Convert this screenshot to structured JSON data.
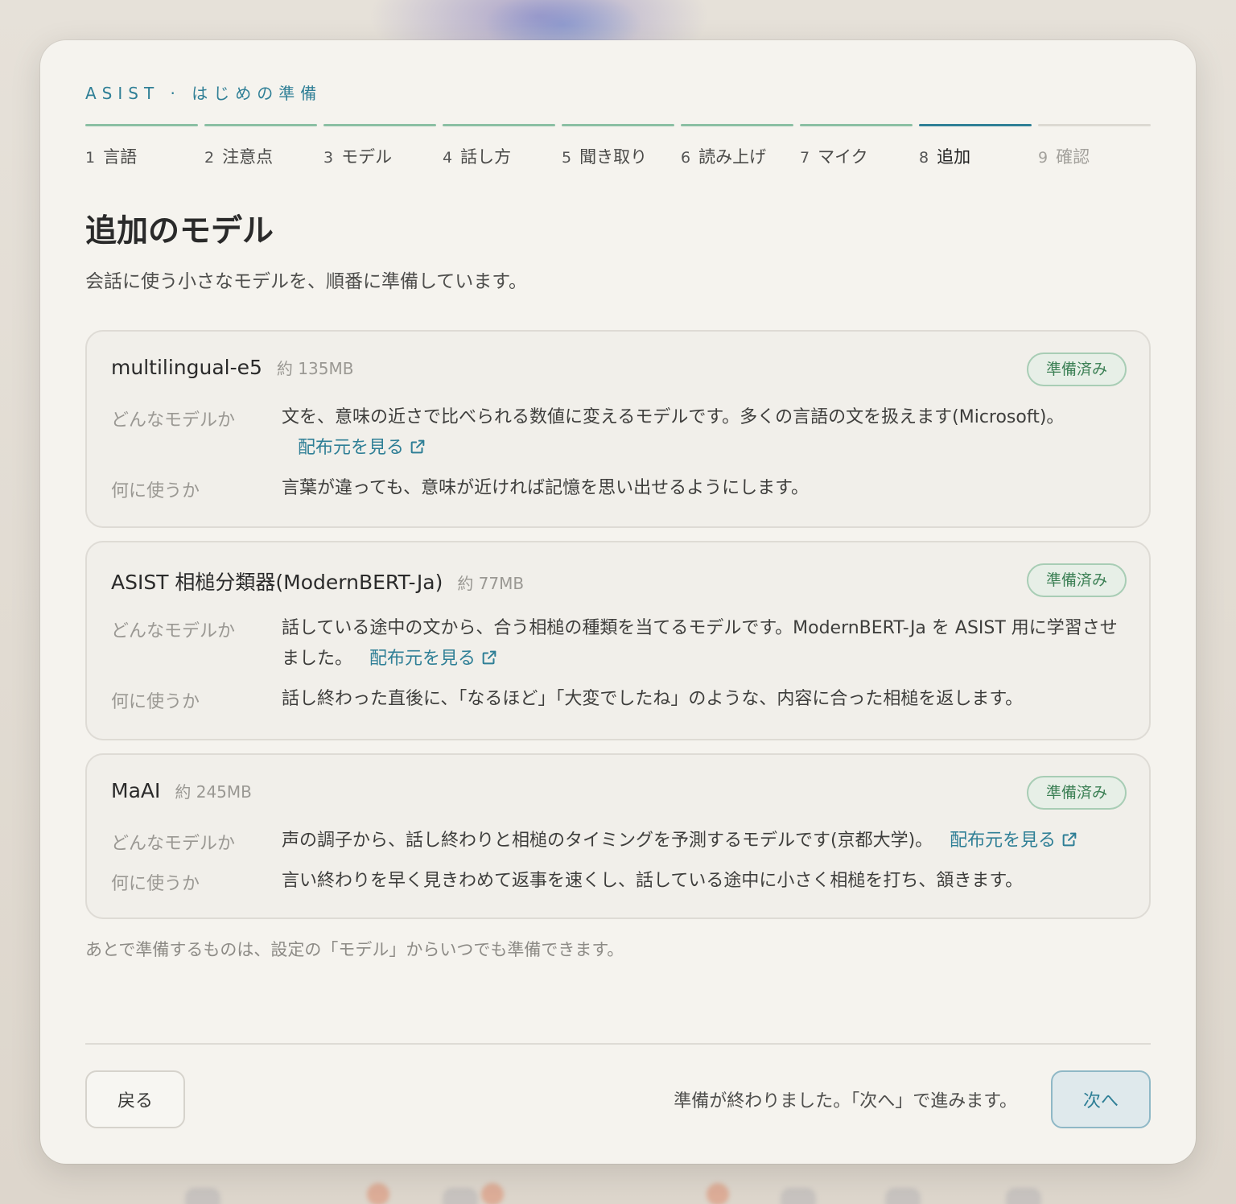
{
  "header": {
    "eyebrow": "ASIST · はじめの準備"
  },
  "steps": [
    {
      "num": "1",
      "label": "言語",
      "state": "done"
    },
    {
      "num": "2",
      "label": "注意点",
      "state": "done"
    },
    {
      "num": "3",
      "label": "モデル",
      "state": "done"
    },
    {
      "num": "4",
      "label": "話し方",
      "state": "done"
    },
    {
      "num": "5",
      "label": "聞き取り",
      "state": "done"
    },
    {
      "num": "6",
      "label": "読み上げ",
      "state": "done"
    },
    {
      "num": "7",
      "label": "マイク",
      "state": "done"
    },
    {
      "num": "8",
      "label": "追加",
      "state": "current"
    },
    {
      "num": "9",
      "label": "確認",
      "state": "future"
    }
  ],
  "page": {
    "title": "追加のモデル",
    "subtitle": "会話に使う小さなモデルを、順番に準備しています。"
  },
  "labels": {
    "what": "どんなモデルか",
    "use": "何に使うか",
    "source_link": "配布元を見る"
  },
  "models": [
    {
      "name": "multilingual-e5",
      "size": "約 135MB",
      "status": "準備済み",
      "description": "文を、意味の近さで比べられる数値に変えるモデルです。多くの言語の文を扱えます(Microsoft)。",
      "usage": "言葉が違っても、意味が近ければ記憶を思い出せるようにします。"
    },
    {
      "name": "ASIST 相槌分類器(ModernBERT-Ja)",
      "size": "約 77MB",
      "status": "準備済み",
      "description": "話している途中の文から、合う相槌の種類を当てるモデルです。ModernBERT-Ja を ASIST 用に学習させました。",
      "usage": "話し終わった直後に、「なるほど」「大変でしたね」のような、内容に合った相槌を返します。"
    },
    {
      "name": "MaAI",
      "size": "約 245MB",
      "status": "準備済み",
      "description": "声の調子から、話し終わりと相槌のタイミングを予測するモデルです(京都大学)。",
      "usage": "言い終わりを早く見きわめて返事を速くし、話している途中に小さく相槌を打ち、頷きます。"
    }
  ],
  "note": "あとで準備するものは、設定の「モデル」からいつでも準備できます。",
  "footer": {
    "back_label": "戻る",
    "status": "準備が終わりました。「次へ」で進みます。",
    "next_label": "次へ"
  },
  "colors": {
    "accent": "#2f7f96",
    "step_done": "#8bbfa3",
    "step_future": "#dcd9d2",
    "ready_badge": "#3c8055",
    "background": "#f5f3ee"
  }
}
